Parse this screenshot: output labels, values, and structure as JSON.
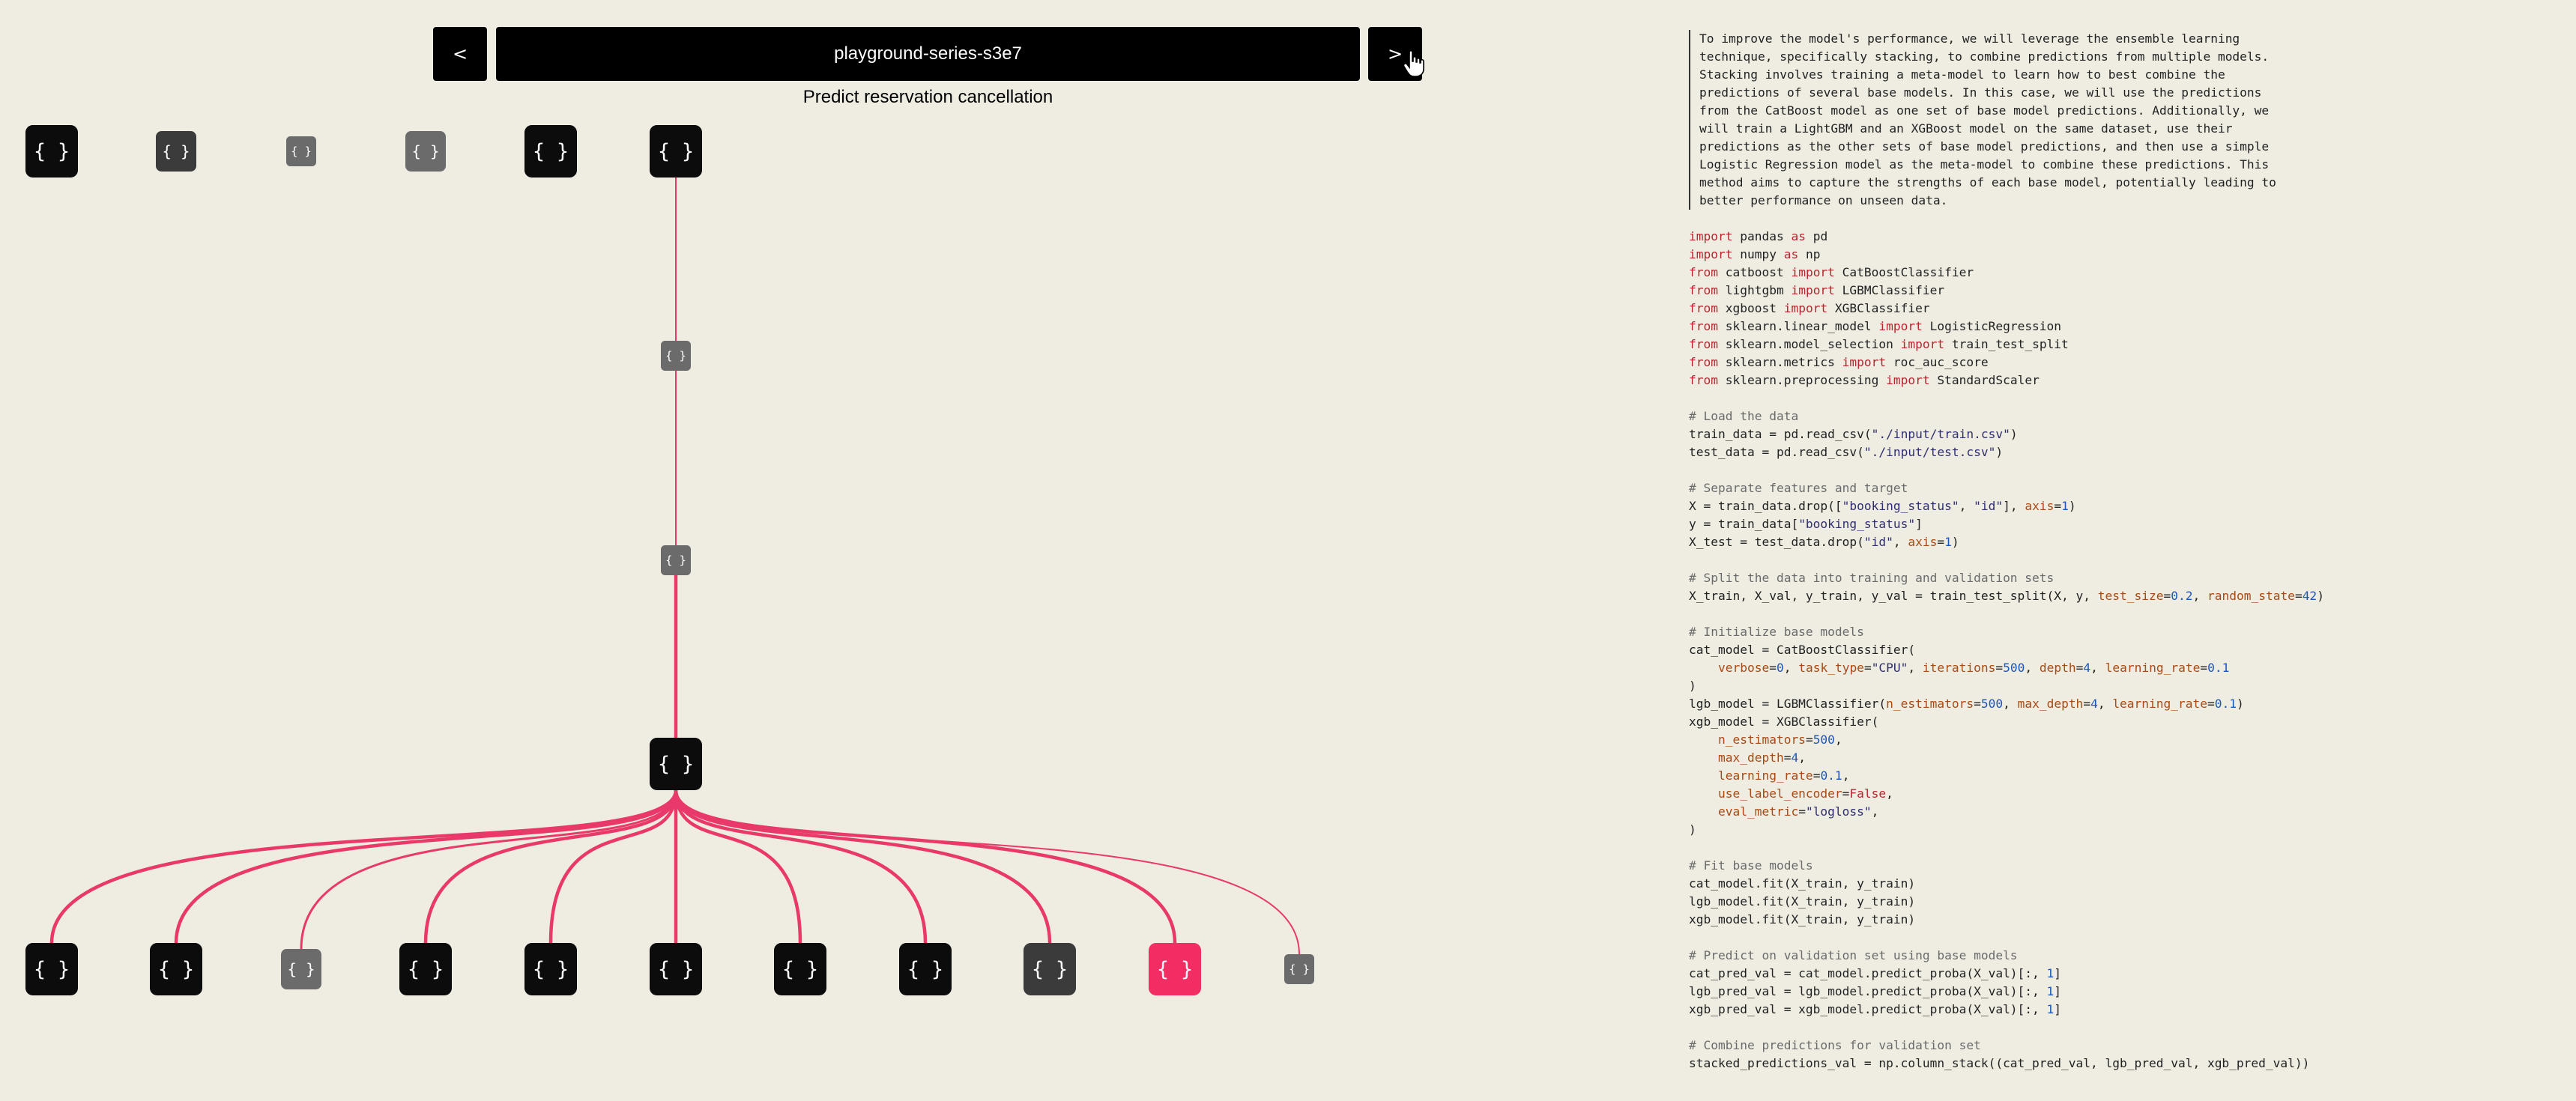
{
  "nav": {
    "prev_label": "<",
    "next_label": ">"
  },
  "header": {
    "title": "playground-series-s3e7",
    "subtitle": "Predict reservation cancellation"
  },
  "colors": {
    "background": "#efece2",
    "node_default": "#0c0c0c",
    "node_dim": "#3b3b3b",
    "node_faded": "#6b6b6b",
    "node_active": "#f22d64",
    "edge": "#e8396a"
  },
  "tree": {
    "node_glyph": "{}",
    "nodes": [
      {
        "id": "r0",
        "name": "tree-node",
        "style": "default",
        "size": "large",
        "label": "{ }"
      },
      {
        "id": "r1",
        "name": "tree-node",
        "style": "dim",
        "size": "medium",
        "label": "{ }"
      },
      {
        "id": "r2",
        "name": "tree-node",
        "style": "faded",
        "size": "small",
        "label": "{ }"
      },
      {
        "id": "r3",
        "name": "tree-node",
        "style": "faded",
        "size": "medium",
        "label": "{ }"
      },
      {
        "id": "r4",
        "name": "tree-node",
        "style": "default",
        "size": "large",
        "label": "{ }"
      },
      {
        "id": "r5",
        "name": "tree-node",
        "style": "default",
        "size": "large",
        "label": "{ }"
      },
      {
        "id": "m1",
        "name": "tree-node",
        "style": "faded",
        "size": "small",
        "label": "{ }"
      },
      {
        "id": "m2",
        "name": "tree-node",
        "style": "faded",
        "size": "small",
        "label": "{ }"
      },
      {
        "id": "m3",
        "name": "tree-node",
        "style": "default",
        "size": "large",
        "label": "{ }"
      },
      {
        "id": "c0",
        "name": "tree-node",
        "style": "default",
        "size": "large",
        "label": "{ }"
      },
      {
        "id": "c1",
        "name": "tree-node",
        "style": "default",
        "size": "large",
        "label": "{ }"
      },
      {
        "id": "c2",
        "name": "tree-node",
        "style": "faded",
        "size": "medium",
        "label": "{ }"
      },
      {
        "id": "c3",
        "name": "tree-node",
        "style": "default",
        "size": "large",
        "label": "{ }"
      },
      {
        "id": "c4",
        "name": "tree-node",
        "style": "default",
        "size": "large",
        "label": "{ }"
      },
      {
        "id": "c5",
        "name": "tree-node",
        "style": "default",
        "size": "large",
        "label": "{ }"
      },
      {
        "id": "c6",
        "name": "tree-node",
        "style": "default",
        "size": "large",
        "label": "{ }"
      },
      {
        "id": "c7",
        "name": "tree-node",
        "style": "default",
        "size": "large",
        "label": "{ }"
      },
      {
        "id": "c8",
        "name": "tree-node",
        "style": "dim",
        "size": "large",
        "label": "{ }"
      },
      {
        "id": "c9",
        "name": "tree-node",
        "style": "active",
        "size": "large",
        "label": "{ }"
      },
      {
        "id": "c10",
        "name": "tree-node",
        "style": "faded",
        "size": "small",
        "label": "{ }"
      }
    ],
    "edges": [
      {
        "from": "r5",
        "to": "m1",
        "weight": "thin"
      },
      {
        "from": "m1",
        "to": "m2",
        "weight": "thin"
      },
      {
        "from": "m2",
        "to": "m3",
        "weight": "bold"
      },
      {
        "from": "m3",
        "to": "c0",
        "weight": "bold"
      },
      {
        "from": "m3",
        "to": "c1",
        "weight": "bold"
      },
      {
        "from": "m3",
        "to": "c2",
        "weight": "medium"
      },
      {
        "from": "m3",
        "to": "c3",
        "weight": "bold"
      },
      {
        "from": "m3",
        "to": "c4",
        "weight": "bold"
      },
      {
        "from": "m3",
        "to": "c5",
        "weight": "bold"
      },
      {
        "from": "m3",
        "to": "c6",
        "weight": "bold"
      },
      {
        "from": "m3",
        "to": "c7",
        "weight": "bold"
      },
      {
        "from": "m3",
        "to": "c8",
        "weight": "bold"
      },
      {
        "from": "m3",
        "to": "c9",
        "weight": "bold"
      },
      {
        "from": "m3",
        "to": "c10",
        "weight": "thin"
      }
    ]
  },
  "notebook": {
    "markdown": "To improve the model's performance, we will leverage the ensemble learning\ntechnique, specifically stacking, to combine predictions from multiple models.\nStacking involves training a meta-model to learn how to best combine the\npredictions of several base models. In this case, we will use the predictions\nfrom the CatBoost model as one set of base model predictions. Additionally, we\nwill train a LightGBM and an XGBoost model on the same dataset, use their\npredictions as the other sets of base model predictions, and then use a simple\nLogistic Regression model as the meta-model to combine these predictions. This\nmethod aims to capture the strengths of each base model, potentially leading to\nbetter performance on unseen data.",
    "code": "import pandas as pd\nimport numpy as np\nfrom catboost import CatBoostClassifier\nfrom lightgbm import LGBMClassifier\nfrom xgboost import XGBClassifier\nfrom sklearn.linear_model import LogisticRegression\nfrom sklearn.model_selection import train_test_split\nfrom sklearn.metrics import roc_auc_score\nfrom sklearn.preprocessing import StandardScaler\n\n# Load the data\ntrain_data = pd.read_csv(\"./input/train.csv\")\ntest_data = pd.read_csv(\"./input/test.csv\")\n\n# Separate features and target\nX = train_data.drop([\"booking_status\", \"id\"], axis=1)\ny = train_data[\"booking_status\"]\nX_test = test_data.drop(\"id\", axis=1)\n\n# Split the data into training and validation sets\nX_train, X_val, y_train, y_val = train_test_split(X, y, test_size=0.2, random_state=42)\n\n# Initialize base models\ncat_model = CatBoostClassifier(\n    verbose=0, task_type=\"CPU\", iterations=500, depth=4, learning_rate=0.1\n)\nlgb_model = LGBMClassifier(n_estimators=500, max_depth=4, learning_rate=0.1)\nxgb_model = XGBClassifier(\n    n_estimators=500,\n    max_depth=4,\n    learning_rate=0.1,\n    use_label_encoder=False,\n    eval_metric=\"logloss\",\n)\n\n# Fit base models\ncat_model.fit(X_train, y_train)\nlgb_model.fit(X_train, y_train)\nxgb_model.fit(X_train, y_train)\n\n# Predict on validation set using base models\ncat_pred_val = cat_model.predict_proba(X_val)[:, 1]\nlgb_pred_val = lgb_model.predict_proba(X_val)[:, 1]\nxgb_pred_val = xgb_model.predict_proba(X_val)[:, 1]\n\n# Combine predictions for validation set\nstacked_predictions_val = np.column_stack((cat_pred_val, lgb_pred_val, xgb_pred_val))"
  }
}
